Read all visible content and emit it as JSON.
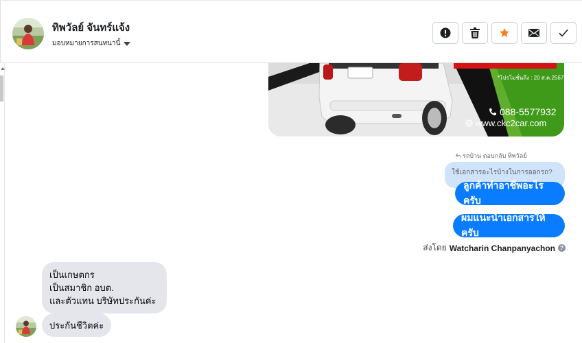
{
  "header": {
    "contact_name": "ทิพวัลย์ จันทร์แจ้ง",
    "assign_label": "มอบหมายการสนทนานี้",
    "avatar_icon": "user-avatar",
    "actions": [
      {
        "name": "report-spam-button",
        "icon": "exclamation-circle-icon"
      },
      {
        "name": "delete-button",
        "icon": "trash-icon"
      },
      {
        "name": "star-button",
        "icon": "star-icon",
        "color": "#f5821f"
      },
      {
        "name": "mark-unread-button",
        "icon": "envelope-icon"
      },
      {
        "name": "mark-done-button",
        "icon": "checkmark-icon"
      }
    ]
  },
  "car_ad": {
    "promo_text": "*โปรโมชั่นถึง : 20 ส.ค.2567",
    "phone": "088-5577932",
    "website": "www.ckc2car.com"
  },
  "reply": {
    "meta": "รถบ้าน ตอบกลับ ทิพวัลย์",
    "quoted_text": "ใช้เอกสารอะไรบ้างในการออกรถ?"
  },
  "outgoing": [
    "ลูกค้าทำอาชีพอะไรครับ",
    "ผมแนะนำเอกสารให้ครับ"
  ],
  "sent_by": {
    "prefix": "ส่งโดย",
    "name": "Watcharin Chanpanyachon"
  },
  "incoming": [
    {
      "lines": [
        "เป็นเกษตกร",
        "เป็นสมาชิก อบต.",
        "และตัวแทน บริษัทประกันค่ะ"
      ]
    },
    {
      "lines": [
        "ประกันชีวิตค่ะ"
      ]
    }
  ],
  "colors": {
    "outgoing_bubble": "#0a7cff",
    "incoming_bubble": "#e4e6eb",
    "quote_bubble": "#cfe3fb",
    "star": "#f5821f"
  }
}
